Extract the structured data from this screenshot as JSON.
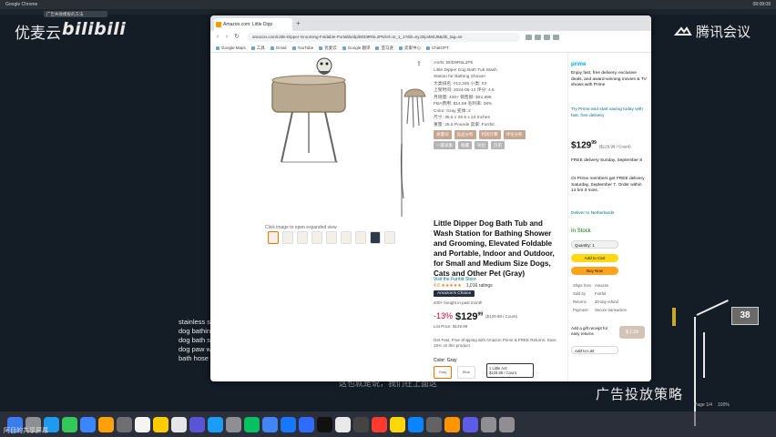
{
  "menubar": {
    "app": "Google Chrome",
    "clock": "08:08:08"
  },
  "top_tab": "广告失败模板的方法",
  "logos": {
    "youku": "优麦云",
    "bilibili": "bilibili",
    "tencent": "腾讯会议"
  },
  "browser": {
    "tab_title": "Amazon.com: Little Dipp",
    "url": "amazon.com/Little-Dipper-Grooming-Foldable-Portable/dp/B0D9R5L2P5/ref=sr_1_1?dib=eyJ2IjoiMSJ9&dib_tag=se",
    "bookmarks": [
      "Google Maps",
      "工具",
      "Gmail",
      "YouTube",
      "优麦云",
      "Google 翻译",
      "亚马逊",
      "卖家中心",
      "ChatGPT"
    ]
  },
  "product": {
    "image_caption": "Click image to open expanded view",
    "title": "Little Dipper Dog Bath Tub and Wash Station for Bathing Shower and Grooming, Elevated Foldable and Portable, Indoor and Outdoor, for Small and Medium Size Dogs, Cats and Other Pet (Gray)",
    "brand": "Visit the Furrbit Store",
    "rating": "4.6 ★★★★★",
    "rating_count": "1,016 ratings",
    "badge": "Amazon's Choice",
    "badge_sub": "",
    "bought": "400+ bought in past month",
    "discount": "-13%",
    "price": "$129",
    "price_cents": "99",
    "unit_price": "($129.99 / Count)",
    "list_price": "List Price: $149.99",
    "coupon": "Get Fast, Free Shipping with Amazon Prime & FREE Returns. Save 15% on this product",
    "color_label": "Color: Gray",
    "swatches": [
      "Gray",
      "Blue"
    ],
    "size_box": [
      "1 Little Ant",
      "$129.99 / Count"
    ]
  },
  "extension": {
    "rows": [
      "ASIN: B0D9R5L2P5",
      "Little Dipper Dog Bath Tub Wash",
      "Station for Bathing Shower",
      "大类排名: #12,345  小类: #3",
      "上架时间: 2024-06-12  评分: 4.6",
      "月销量: 400+   销售额: $51,996",
      "FBA费用: $14.88  毛利率: 38%",
      "Color: Gray   变体: 2",
      "尺寸: 35.5 x 26.5 x 24 Inches",
      "重量: 25.6 Pounds   卖家: Furrbit"
    ],
    "buttons": [
      "关键词",
      "竞品分析",
      "利润计算",
      "评论分析"
    ],
    "buttons2": [
      "一键采集",
      "收藏",
      "导出",
      "历史"
    ]
  },
  "buybox": {
    "prime": "prime",
    "prime_text": "Enjoy fast, free delivery, exclusive deals, and award-winning movies & TV shows with Prime",
    "prime_cta": "Try Prime and start saving today with fast, free delivery",
    "price": "$129",
    "price_cents": "99",
    "price_unit": "($129.99 / Count)",
    "delivery": "FREE delivery Sunday, September 8",
    "fastest": "Or Prime members get FREE delivery Saturday, September 7. Order within 14 hrs 3 mins.",
    "location": "Deliver to Netherlands",
    "in_stock": "In Stock",
    "qty": "Quantity: 1",
    "add_to_cart": "Add to Cart",
    "buy_now": "Buy Now",
    "table": [
      [
        "Ships from",
        "Amazon"
      ],
      [
        "Sold by",
        "Furrbit"
      ],
      [
        "Returns",
        "30-day refund"
      ],
      [
        "Payment",
        "Secure transaction"
      ]
    ],
    "gift": "Add a gift receipt for easy returns",
    "gift_btn": "$ 1:24",
    "add_list": "Add to List"
  },
  "background": {
    "list": [
      "stainless steel",
      "dog bathing",
      "dog bath sho",
      "dog paw was",
      "bath hose"
    ],
    "subtitle": "这也就是说，我们在上面这",
    "strategy": "广告投放策略",
    "badge": "38",
    "zoom": [
      "Page 1/4",
      "100%"
    ],
    "bottom": "阿目的共享屏幕"
  },
  "colors": {
    "amazon_orange": "#ff9900",
    "buy_yellow": "#ffd814",
    "deal_red": "#cc0c39"
  }
}
